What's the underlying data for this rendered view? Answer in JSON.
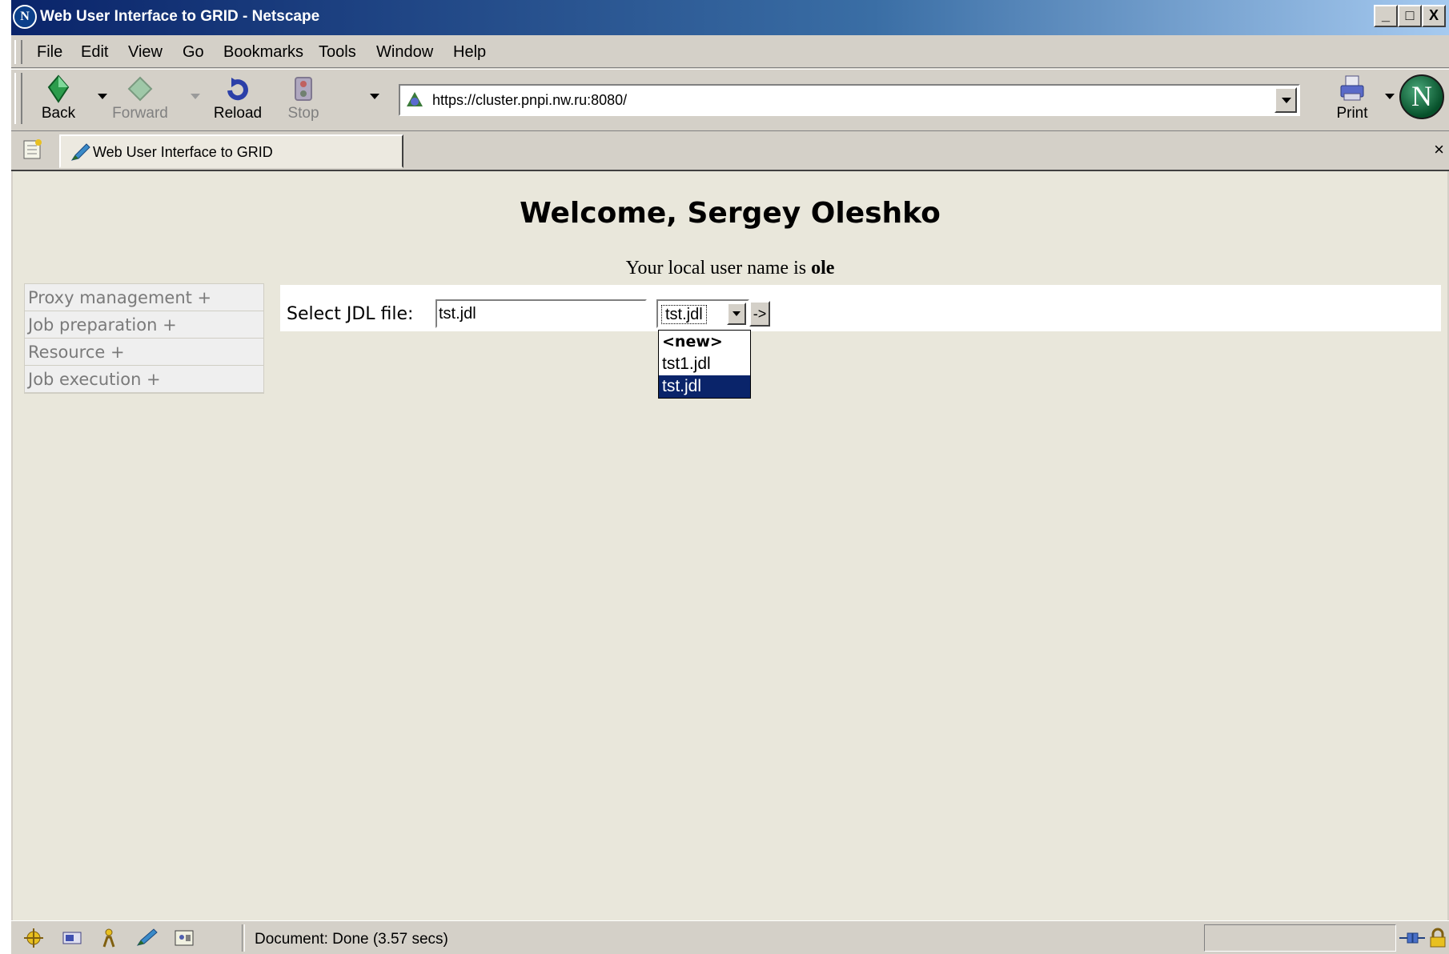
{
  "window": {
    "title": "Web User Interface to GRID - Netscape",
    "logo": "N",
    "controls": [
      "_",
      "□",
      "X"
    ]
  },
  "menu": {
    "items": [
      "File",
      "Edit",
      "View",
      "Go",
      "Bookmarks",
      "Tools",
      "Window",
      "Help"
    ]
  },
  "toolbar": {
    "back": "Back",
    "forward": "Forward",
    "reload": "Reload",
    "stop": "Stop",
    "print": "Print",
    "url": "https://cluster.pnpi.nw.ru:8080/",
    "logo": "N"
  },
  "tabs": {
    "items": [
      {
        "label": "Web User Interface to GRID"
      }
    ],
    "close": "×"
  },
  "page": {
    "welcome": "Welcome, Sergey Oleshko",
    "username_prefix": "Your local user name is ",
    "username": "ole",
    "sidebar": [
      "Proxy management +",
      "Job preparation +",
      "Resource +",
      "Job execution +"
    ],
    "jdl": {
      "label": "Select JDL file:",
      "file_value": "tst.jdl",
      "selected": "tst.jdl",
      "go": "->",
      "options": [
        "<new>",
        "tst1.jdl",
        "tst.jdl"
      ]
    }
  },
  "status": {
    "text": "Document: Done (3.57 secs)"
  },
  "colors": {
    "titlebar": "#0a246a",
    "chrome": "#d4d0c8",
    "page_bg": "#e9e7db",
    "selection": "#0a246a"
  }
}
